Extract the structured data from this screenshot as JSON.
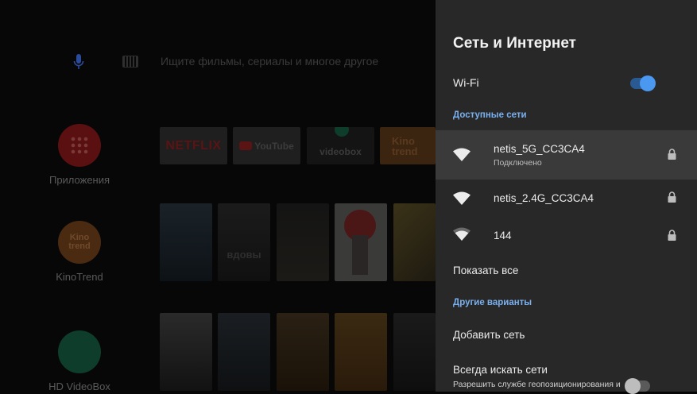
{
  "launcher": {
    "search_placeholder": "Ищите фильмы, сериалы и многое другое",
    "apps": [
      {
        "label": "Приложения"
      },
      {
        "label": "KinoTrend",
        "logo_text": "Kino trend"
      },
      {
        "label": "HD VideoBox"
      }
    ],
    "channels": {
      "netflix": "NETFLIX",
      "youtube": "YouTube",
      "videobox": "videobox",
      "kinotrend": "Kino trend"
    },
    "posters_row1": {
      "vdovy": "вдовы"
    }
  },
  "settings": {
    "title": "Сеть и Интернет",
    "wifi_label": "Wi-Fi",
    "wifi_on": true,
    "available_section": "Доступные сети",
    "networks": [
      {
        "name": "netis_5G_CC3CA4",
        "status": "Подключено",
        "locked": true,
        "selected": true
      },
      {
        "name": "netis_2.4G_CC3CA4",
        "status": "",
        "locked": true,
        "selected": false
      },
      {
        "name": "144",
        "status": "",
        "locked": true,
        "selected": false
      }
    ],
    "show_all": "Показать все",
    "other_section": "Другие варианты",
    "add_network": "Добавить сеть",
    "always_scan": {
      "title": "Всегда искать сети",
      "description": "Разрешить службе геопозиционирования и",
      "enabled": false
    },
    "colors": {
      "accent": "#7bb0ef",
      "toggle_on": "#4a98f0",
      "panel": "#282828"
    }
  }
}
